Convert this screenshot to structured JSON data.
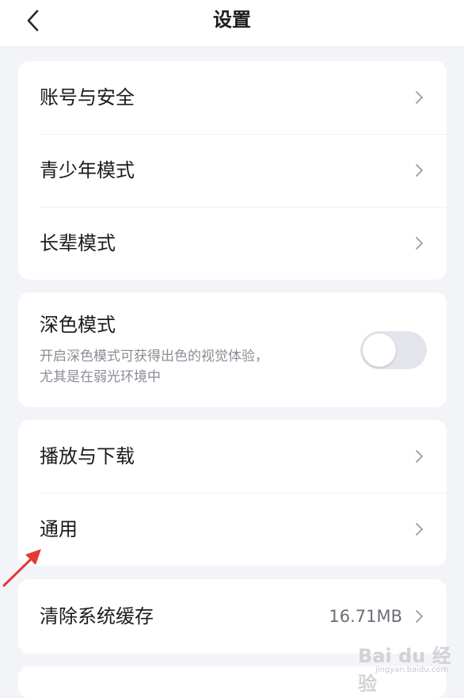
{
  "header": {
    "title": "设置",
    "back_icon": "chevron-left-icon"
  },
  "account_group": {
    "items": [
      {
        "label": "账号与安全",
        "icon": "chevron-right-icon"
      },
      {
        "label": "青少年模式",
        "icon": "chevron-right-icon"
      },
      {
        "label": "长辈模式",
        "icon": "chevron-right-icon"
      }
    ]
  },
  "dark_mode": {
    "title": "深色模式",
    "desc_line1": "开启深色模式可获得出色的视觉体验，",
    "desc_line2": "尤其是在弱光环境中",
    "enabled": false
  },
  "general_group": {
    "items": [
      {
        "label": "播放与下载",
        "icon": "chevron-right-icon"
      },
      {
        "label": "通用",
        "icon": "chevron-right-icon"
      }
    ]
  },
  "cache": {
    "label": "清除系统缓存",
    "value": "16.71MB",
    "icon": "chevron-right-icon"
  },
  "annotation": {
    "arrow_color": "#e53935"
  },
  "watermark": {
    "brand": "Bai du 经验",
    "sub": "jingyan.baidu.com"
  },
  "colors": {
    "background": "#f2f4f8",
    "card": "#ffffff",
    "text": "#1b1b1f",
    "secondary_text": "#8a8d95",
    "toggle_off": "#e3e5ea"
  }
}
